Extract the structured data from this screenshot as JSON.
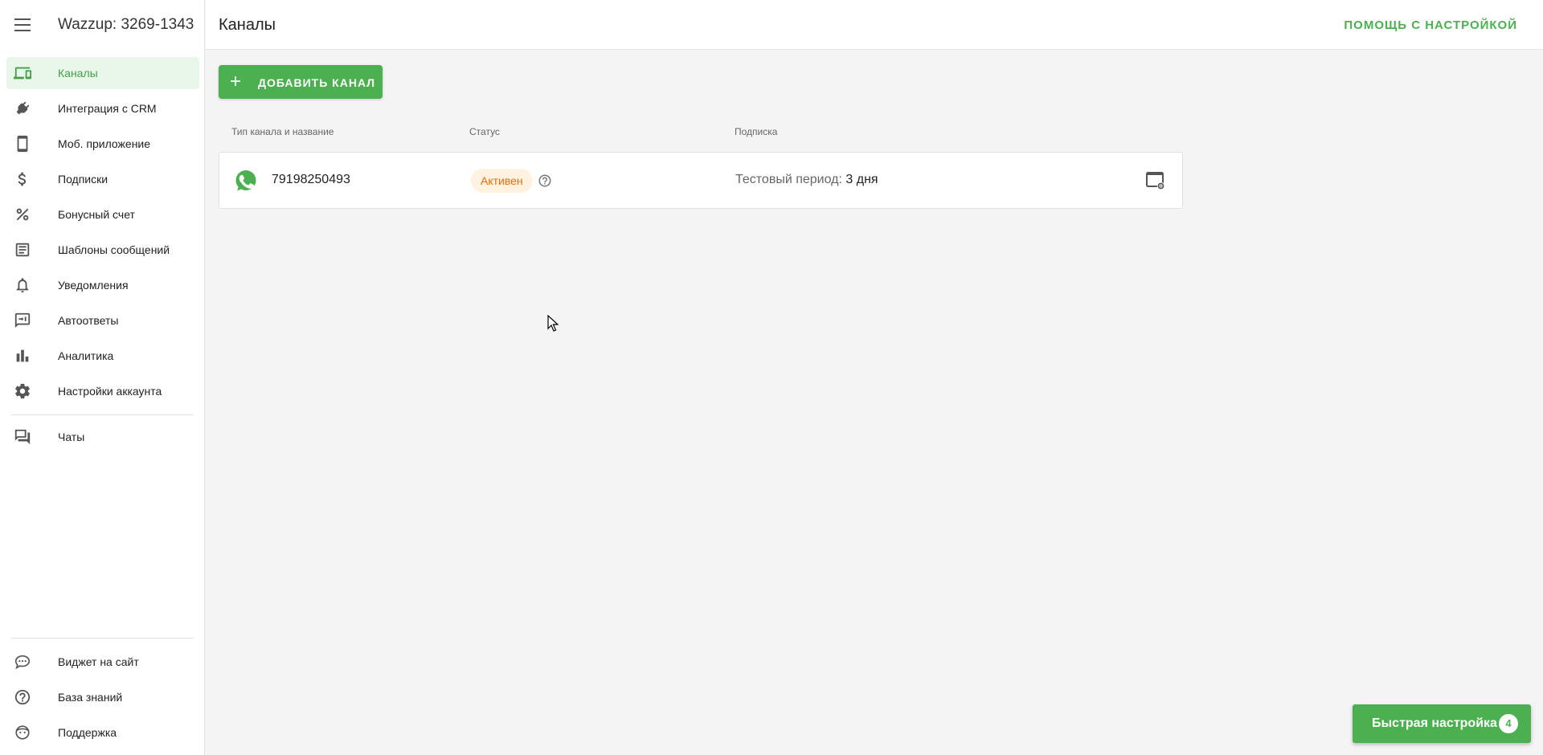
{
  "app": {
    "account_title": "Wazzup: 3269-1343",
    "accent": "#4caf50"
  },
  "sidebar": {
    "items": [
      {
        "label": "Каналы",
        "icon": "devices-icon",
        "active": true
      },
      {
        "label": "Интеграция с CRM",
        "icon": "plug-icon"
      },
      {
        "label": "Моб. приложение",
        "icon": "smartphone-icon"
      },
      {
        "label": "Подписки",
        "icon": "dollar-icon"
      },
      {
        "label": "Бонусный счет",
        "icon": "percent-icon"
      },
      {
        "label": "Шаблоны сообщений",
        "icon": "document-icon"
      },
      {
        "label": "Уведомления",
        "icon": "bell-icon"
      },
      {
        "label": "Автоответы",
        "icon": "autoreply-icon"
      },
      {
        "label": "Аналитика",
        "icon": "bar-chart-icon"
      },
      {
        "label": "Настройки аккаунта",
        "icon": "gear-icon"
      },
      {
        "label": "Чаты",
        "icon": "chat-icon"
      }
    ],
    "bottom_items": [
      {
        "label": "Виджет на сайт",
        "icon": "chat-bubble-icon"
      },
      {
        "label": "База знаний",
        "icon": "help-circle-icon"
      },
      {
        "label": "Поддержка",
        "icon": "support-face-icon"
      }
    ]
  },
  "header": {
    "title": "Каналы",
    "help_label": "ПОМОЩЬ С НАСТРОЙКОЙ"
  },
  "main": {
    "add_button": {
      "icon": "+",
      "label": "ДОБАВИТЬ КАНАЛ"
    },
    "columns": [
      "Тип канала и название",
      "Статус",
      "Подписка"
    ],
    "rows": [
      {
        "channel_icon": "whatsapp-icon",
        "name": "79198250493",
        "status": "Активен",
        "status_color": "#ef6c00",
        "subscription_label": "Тестовый период:",
        "subscription_value": "3 дня"
      }
    ]
  },
  "quick_setup": {
    "label": "Быстрая настройка",
    "count": "4"
  }
}
